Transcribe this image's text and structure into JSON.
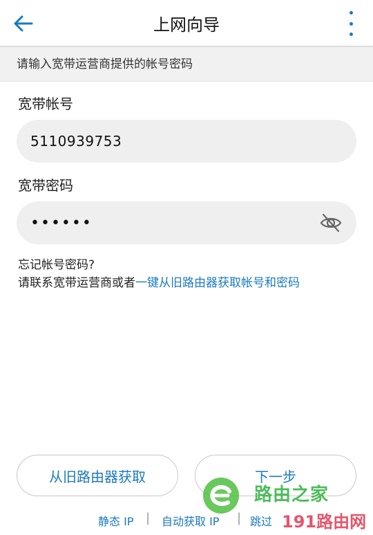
{
  "header": {
    "title": "上网向导",
    "back_icon": "arrow-left-icon",
    "more_icon": "more-vert-icon",
    "accent": "#1a7ac0"
  },
  "banner": {
    "text": "请输入宽带运营商提供的帐号密码"
  },
  "account": {
    "label": "宽带帐号",
    "value": "5110939753"
  },
  "password": {
    "label": "宽带密码",
    "value": "••••••",
    "toggle_icon": "eye-off-icon"
  },
  "forgot": {
    "line1": "忘记帐号密码?",
    "line2_prefix": "请联系宽带运营商或者",
    "line2_link": "一键从旧路由器获取帐号和密码"
  },
  "buttons": {
    "from_old_router": "从旧路由器获取",
    "next_step": "下一步"
  },
  "bottom_links": {
    "static_ip": "静态 IP",
    "auto_ip": "自动获取 IP",
    "skip": "跳过"
  },
  "watermark": {
    "text1": "路由之家",
    "text2": "191路由网",
    "logo_icon": "router-home-logo-icon"
  }
}
